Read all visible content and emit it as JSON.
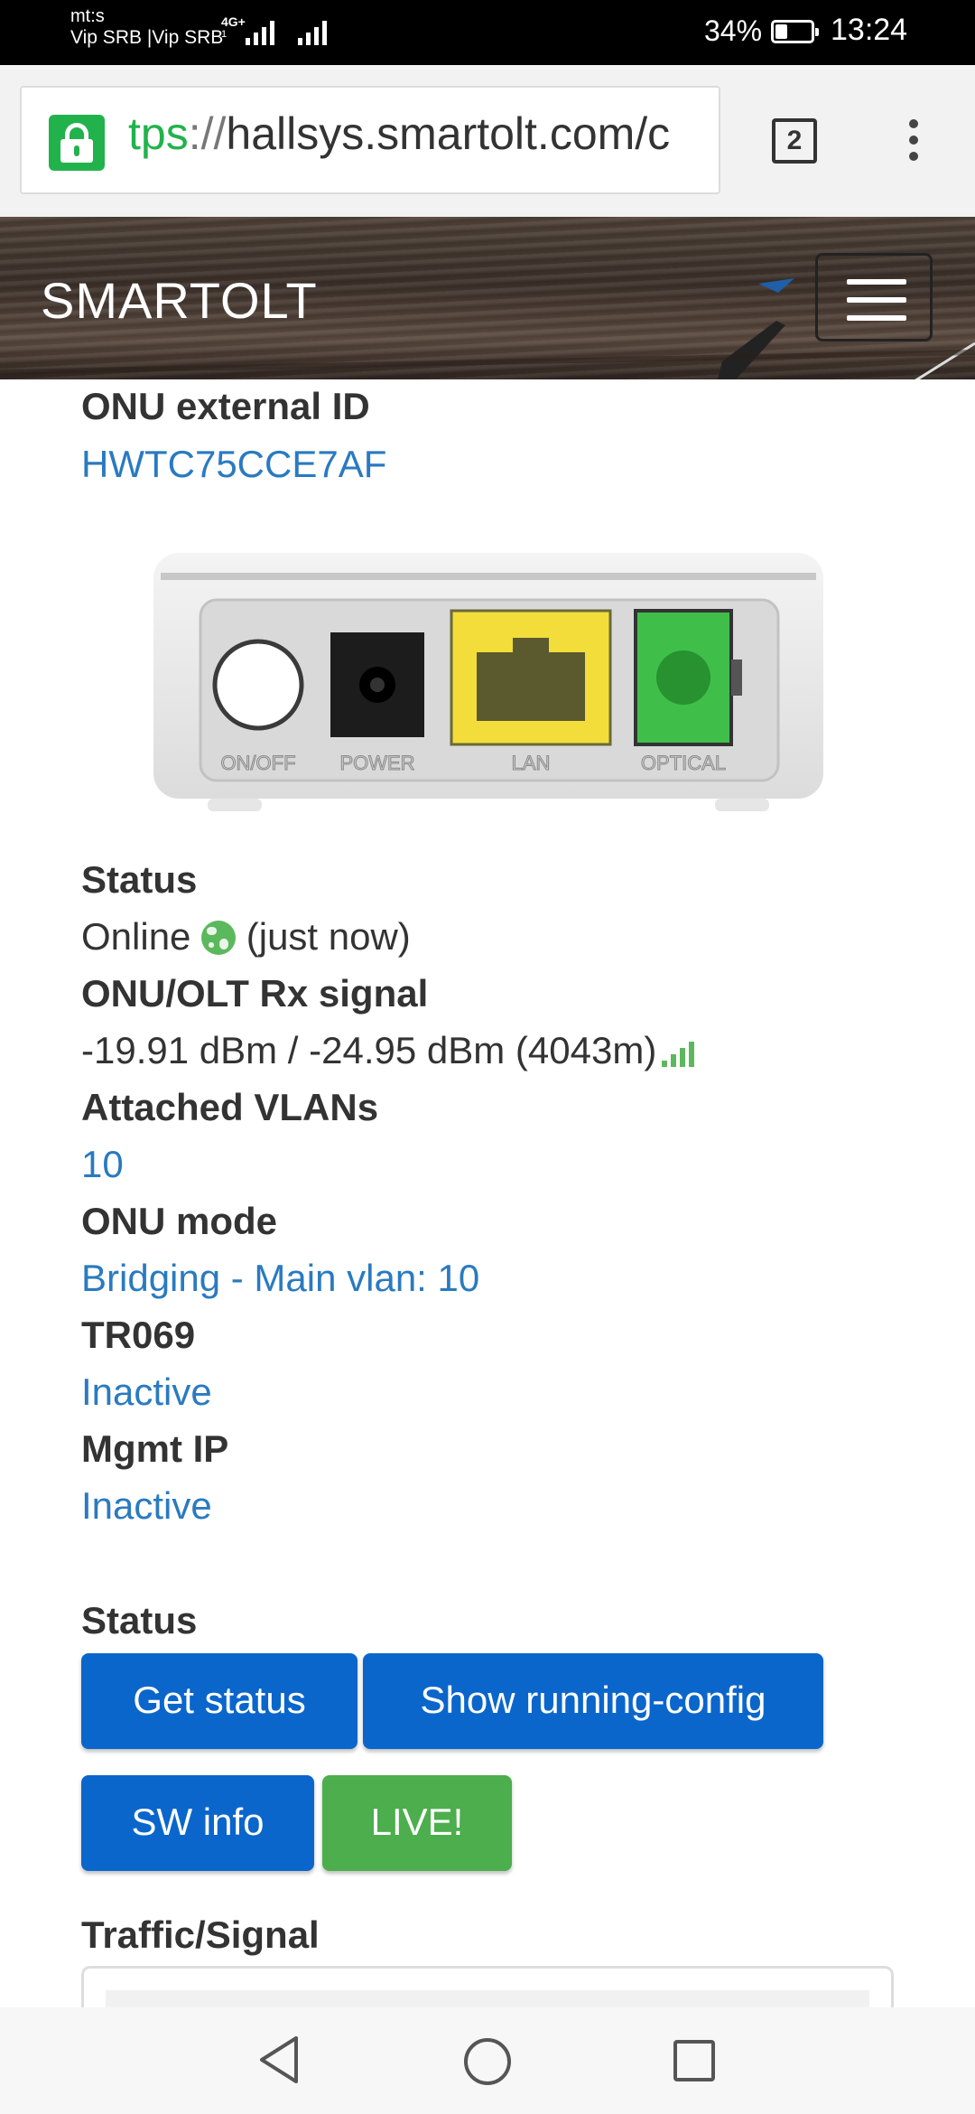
{
  "status_bar": {
    "carrier_line1": "mt:s",
    "carrier_line2": "Vip SRB |Vip SRB",
    "network_type": "4G+",
    "network_sub": "1",
    "battery_percent": "34%",
    "battery_level": 0.34,
    "time": "13:24"
  },
  "browser": {
    "url_scheme": "tps",
    "url_sep": "://",
    "url_host": "hallsys.smartolt.com/c",
    "tab_count": "2",
    "lock_icon": "lock-icon",
    "menu_icon": "kebab-menu-icon"
  },
  "navbar": {
    "brand": "SMARTOLT",
    "menu_icon": "hamburger-icon"
  },
  "details": {
    "external_id_label": "ONU external ID",
    "external_id_value": "HWTC75CCE7AF",
    "device_port_labels": [
      "ON/OFF",
      "POWER",
      "LAN",
      "OPTICAL"
    ],
    "status_label": "Status",
    "status_value": "Online",
    "status_time": "(just now)",
    "rx_label": "ONU/OLT Rx signal",
    "rx_value": "-19.91 dBm / -24.95 dBm (4043m)",
    "vlans_label": "Attached VLANs",
    "vlans_value": "10",
    "mode_label": "ONU mode",
    "mode_value": "Bridging - Main vlan: 10",
    "tr069_label": "TR069",
    "tr069_value": "Inactive",
    "mgmt_label": "Mgmt IP",
    "mgmt_value": "Inactive"
  },
  "actions": {
    "section_label": "Status",
    "get_status": "Get status",
    "show_config": "Show running-config",
    "sw_info": "SW info",
    "live": "LIVE!"
  },
  "traffic": {
    "section_label": "Traffic/Signal"
  },
  "colors": {
    "link": "#2a7ac0",
    "primary_button": "#0b66cc",
    "success_button": "#4cae4c",
    "lock_green": "#22b24c"
  }
}
